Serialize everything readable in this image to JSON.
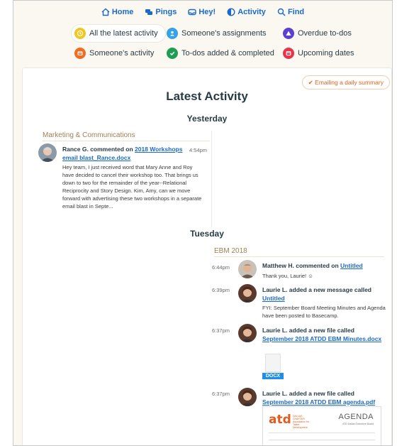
{
  "nav": {
    "items": [
      {
        "label": "Home",
        "icon": "home-icon"
      },
      {
        "label": "Pings",
        "icon": "pings-icon"
      },
      {
        "label": "Hey!",
        "icon": "hey-icon"
      },
      {
        "label": "Activity",
        "icon": "activity-icon"
      },
      {
        "label": "Find",
        "icon": "find-icon"
      }
    ]
  },
  "filters": [
    {
      "label": "All the latest activity",
      "color": "#f5c518",
      "icon": "clock-icon",
      "active": true
    },
    {
      "label": "Someone's assignments",
      "color": "#35a3e8",
      "icon": "person-icon",
      "active": false
    },
    {
      "label": "Overdue to-dos",
      "color": "#5b3fd1",
      "icon": "warning-icon",
      "active": false
    },
    {
      "label": "Someone's activity",
      "color": "#f26b21",
      "icon": "card-icon",
      "active": false
    },
    {
      "label": "To-dos added & completed",
      "color": "#1f9d55",
      "icon": "check-icon",
      "active": false
    },
    {
      "label": "Upcoming dates",
      "color": "#e8334a",
      "icon": "calendar-icon",
      "active": false
    }
  ],
  "email_summary": "✔ Emailing a daily summary",
  "page_title": "Latest Activity",
  "days": {
    "yesterday": "Yesterday",
    "tuesday": "Tuesday"
  },
  "projects": {
    "left": "Marketing & Communications",
    "right": "EBM 2018"
  },
  "events": {
    "rance": {
      "actor": "Rance G. commented on ",
      "link": "2018 Workshops email blast_Rance.docx",
      "time": "4:54pm",
      "body": "Hey team, I just received word that Mary Anne and Roy have decided to cancel their workshop too. That brings us down to two for the remainder of the year--Relational Reciprocity and Story Design. Kim, Amy, can we move forward with advertising these two workshops in a separate email blast in Septe..."
    },
    "matthew": {
      "actor": "Matthew H. commented on ",
      "link": "Untitled",
      "time": "6:44pm",
      "body": "Thank you, Laurie! ☺"
    },
    "laurie1": {
      "actor": "Laurie L. added a new message called",
      "link": "Untitled",
      "time": "6:39pm",
      "body": "FYI: September Board Meeting Minutes and Agenda have been posted to Basecamp."
    },
    "laurie2": {
      "actor": "Laurie L. added a new file called",
      "link": "September 2018 ATDD EBM Minutes.docx",
      "time": "6:37pm",
      "file_tag": "DOCX"
    },
    "laurie3": {
      "actor": "Laurie L. added a new file called",
      "link": "September 2018 ATDD EBM agenda.pdf",
      "time": "6:37pm",
      "pdf_logo": "atd",
      "pdf_org": "DALLAS CHAPTER Association for Talent Development",
      "pdf_heading": "AGENDA",
      "pdf_sub": "ATD Dallas Executive Board"
    }
  }
}
